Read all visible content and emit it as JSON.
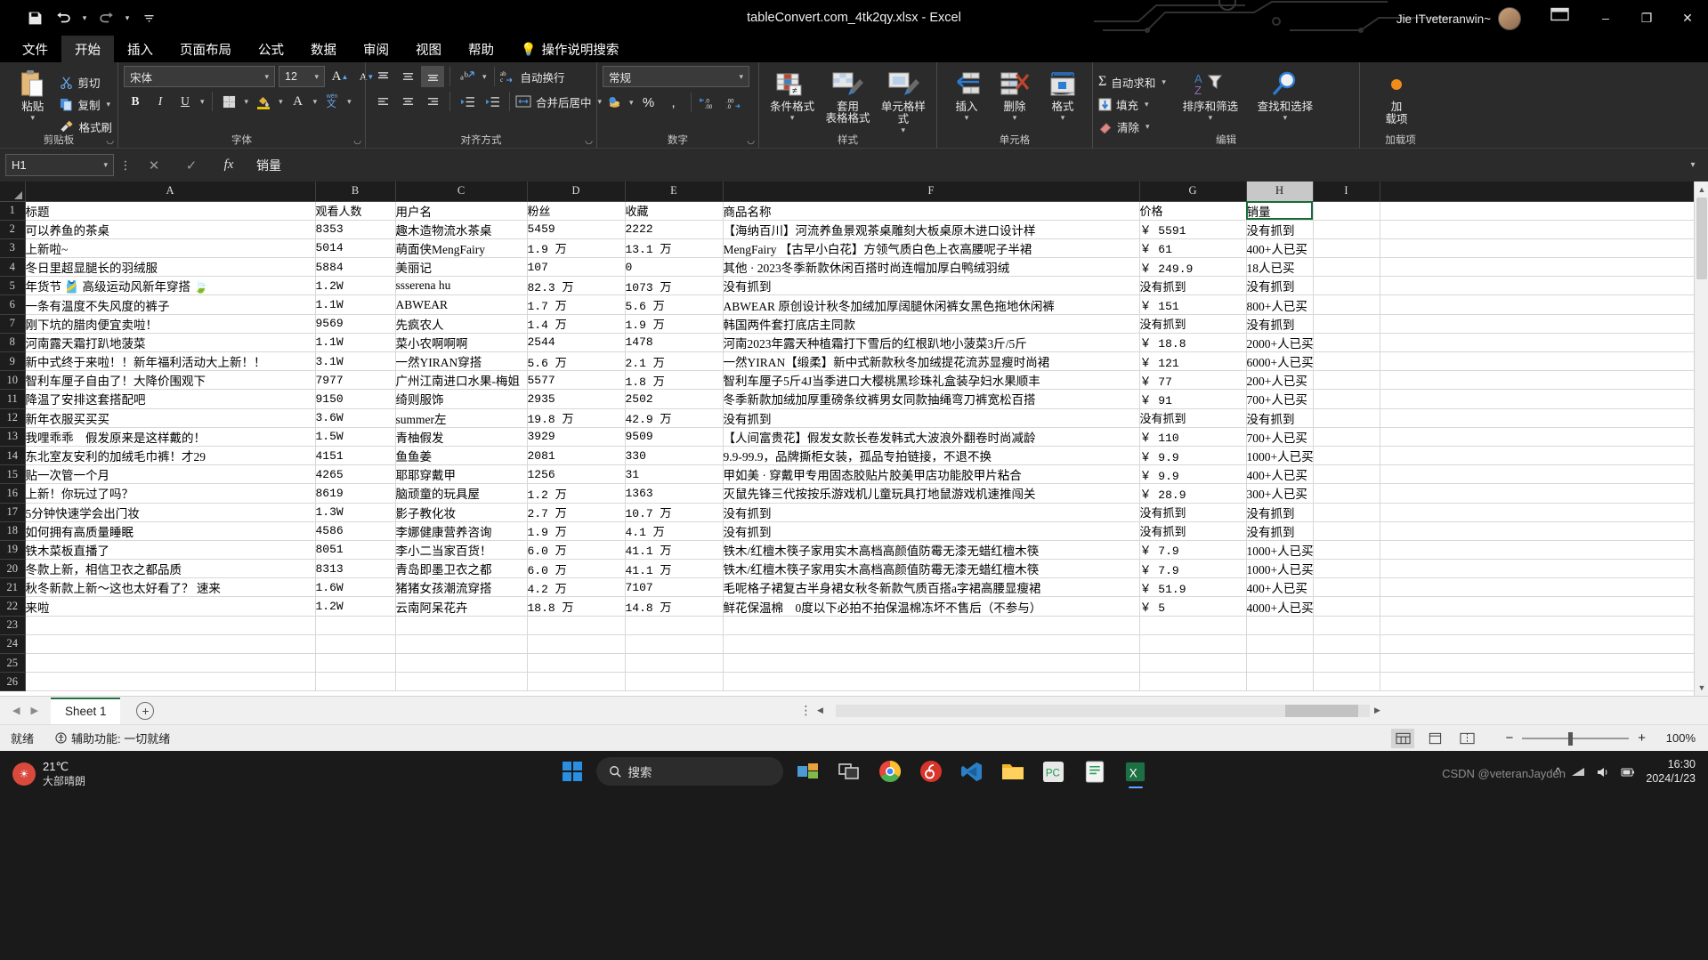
{
  "titlebar": {
    "document_title": "tableConvert.com_4tk2qy.xlsx  -  Excel",
    "account_name": "Jie ITveteranwin~",
    "qat": {
      "save": "save-icon",
      "undo": "undo-icon",
      "redo": "redo-icon",
      "customize": "customize-icon"
    },
    "window": {
      "minimize": "–",
      "maximize": "❐",
      "close": "✕",
      "ribbon_display": "⬚"
    }
  },
  "tabs": [
    {
      "label": "文件",
      "active": false
    },
    {
      "label": "开始",
      "active": true
    },
    {
      "label": "插入",
      "active": false
    },
    {
      "label": "页面布局",
      "active": false
    },
    {
      "label": "公式",
      "active": false
    },
    {
      "label": "数据",
      "active": false
    },
    {
      "label": "审阅",
      "active": false
    },
    {
      "label": "视图",
      "active": false
    },
    {
      "label": "帮助",
      "active": false
    }
  ],
  "tell_me": "操作说明搜索",
  "ribbon": {
    "clipboard": {
      "group_label": "剪贴板",
      "paste": "粘贴",
      "cut": "剪切",
      "copy": "复制",
      "format_painter": "格式刷"
    },
    "font": {
      "group_label": "字体",
      "font_name": "宋体",
      "font_size": "12",
      "bold": "B",
      "italic": "I",
      "underline": "U",
      "grow_font": "A",
      "shrink_font": "A",
      "phonetic": "文",
      "border": "border-icon",
      "fill_color": "fill-color-icon",
      "font_color": "font-color-icon"
    },
    "alignment": {
      "group_label": "对齐方式",
      "wrap_text": "自动换行",
      "merge_center": "合并后居中",
      "orientation": "orientation-icon",
      "indent_decrease": "decrease-indent-icon",
      "indent_increase": "increase-indent-icon"
    },
    "number": {
      "group_label": "数字",
      "format": "常规",
      "currency": "currency-icon",
      "percent": "%",
      "comma": ",",
      "increase_decimal": ".00",
      "decrease_decimal": ".0"
    },
    "styles": {
      "group_label": "样式",
      "conditional": "条件格式",
      "table_format_line1": "套用",
      "table_format_line2": "表格格式",
      "cell_styles": "单元格样式"
    },
    "cells": {
      "group_label": "单元格",
      "insert": "插入",
      "delete": "删除",
      "format": "格式"
    },
    "editing": {
      "group_label": "编辑",
      "autosum": "自动求和",
      "fill": "填充",
      "clear": "清除",
      "sort_filter": "排序和筛选",
      "find_select": "查找和选择"
    },
    "addins": {
      "group_label": "加载项",
      "line1": "加",
      "line2": "载项"
    }
  },
  "formula_bar": {
    "name_box": "H1",
    "cancel": "✕",
    "enter": "✓",
    "fx": "fx",
    "value": "销量"
  },
  "grid": {
    "column_headers": [
      "A",
      "B",
      "C",
      "D",
      "E",
      "F",
      "G",
      "H",
      "I"
    ],
    "selected_column": "H",
    "selected_cell": "H1",
    "row_numbers": [
      1,
      2,
      3,
      4,
      5,
      6,
      7,
      8,
      9,
      10,
      11,
      12,
      13,
      14,
      15,
      16,
      17,
      18,
      19,
      20,
      21,
      22,
      23,
      24,
      25,
      26
    ],
    "header_row": [
      "标题",
      "观看人数",
      "用户名",
      "粉丝",
      "收藏",
      "商品名称",
      "价格",
      "销量",
      ""
    ],
    "rows": [
      [
        "可以养鱼的茶桌",
        "8353",
        "趣木造物流水茶桌",
        "5459",
        "2222",
        "【海纳百川】河流养鱼景观茶桌雕刻大板桌原木进口设计样",
        "￥ 5591",
        "没有抓到",
        ""
      ],
      [
        "上新啦~",
        "5014",
        "萌面侠MengFairy",
        "1.9 万",
        "13.1 万",
        "MengFairy 【古早小白花】方领气质白色上衣高腰呢子半裙",
        "￥ 61",
        "400+人已买",
        ""
      ],
      [
        "冬日里超显腿长的羽绒服",
        "5884",
        "美丽记",
        "107",
        "0",
        "其他 ·  2023冬季新款休闲百搭时尚连帽加厚白鸭绒羽绒",
        "￥ 249.9",
        "18人已买",
        ""
      ],
      [
        "年货节 🎽 高级运动风新年穿搭 🍃",
        "1.2W",
        "ssserena hu",
        "82.3 万",
        "1073 万",
        "没有抓到",
        "没有抓到",
        "没有抓到",
        ""
      ],
      [
        "一条有温度不失风度的裤子",
        "1.1W",
        "ABWEAR",
        "1.7 万",
        "5.6 万",
        "ABWEAR 原创设计秋冬加绒加厚阔腿休闲裤女黑色拖地休闲裤",
        "￥ 151",
        "800+人已买",
        ""
      ],
      [
        "刚下坑的腊肉便宜卖啦！",
        "9569",
        "先疯农人",
        "1.4 万",
        "1.9 万",
        "韩国两件套打底店主同款",
        "没有抓到",
        "没有抓到",
        ""
      ],
      [
        "河南露天霜打趴地菠菜",
        "1.1W",
        "菜小农啊啊啊",
        "2544",
        "1478",
        "河南2023年露天种植霜打下雪后的红根趴地小菠菜3斤/5斤",
        "￥ 18.8",
        "2000+人已买",
        ""
      ],
      [
        "新中式终于来啦！！新年福利活动大上新！！",
        "3.1W",
        "一然YIRAN穿搭",
        "5.6 万",
        "2.1 万",
        "一然YIRAN【缎柔】新中式新款秋冬加绒提花流苏显瘦时尚裙",
        "￥ 121",
        "6000+人已买",
        ""
      ],
      [
        "智利车厘子自由了！大降价围观下",
        "7977",
        "广州江南进口水果-梅姐",
        "5577",
        "1.8 万",
        "智利车厘子5斤4J当季进口大樱桃黑珍珠礼盒装孕妇水果顺丰",
        "￥ 77",
        "200+人已买",
        ""
      ],
      [
        "降温了安排这套搭配吧",
        "9150",
        "绮则服饰",
        "2935",
        "2502",
        "冬季新款加绒加厚重磅条纹裤男女同款抽绳弯刀裤宽松百搭",
        "￥ 91",
        "700+人已买",
        ""
      ],
      [
        "新年衣服买买买",
        "3.6W",
        "summer左",
        "19.8 万",
        "42.9 万",
        "没有抓到",
        "没有抓到",
        "没有抓到",
        ""
      ],
      [
        "我哩乖乖　假发原来是这样戴的！",
        "1.5W",
        "青柚假发",
        "3929",
        "9509",
        "【人间富贵花】假发女款长卷发韩式大波浪外翻卷时尚减龄",
        "￥ 110",
        "700+人已买",
        ""
      ],
      [
        "东北室友安利的加绒毛巾裤！才29",
        "4151",
        "鱼鱼姜",
        "2081",
        "330",
        "9.9-99.9，品牌撕柜女装，孤品专拍链接，不退不换",
        "￥ 9.9",
        "1000+人已买",
        ""
      ],
      [
        "贴一次管一个月",
        "4265",
        "耶耶穿戴甲",
        "1256",
        "31",
        "甲如美 ·  穿戴甲专用固态胶贴片胶美甲店功能胶甲片粘合",
        "￥ 9.9",
        "400+人已买",
        ""
      ],
      [
        "上新！你玩过了吗？",
        "8619",
        "脑顽童的玩具屋",
        "1.2 万",
        "1363",
        "灭鼠先锋三代按按乐游戏机儿童玩具打地鼠游戏机速推闯关",
        "￥ 28.9",
        "300+人已买",
        ""
      ],
      [
        "5分钟快速学会出门妆",
        "1.3W",
        "影子教化妆",
        "2.7 万",
        "10.7 万",
        "没有抓到",
        "没有抓到",
        "没有抓到",
        ""
      ],
      [
        "如何拥有高质量睡眠",
        "4586",
        "李娜健康营养咨询",
        "1.9 万",
        "4.1 万",
        "没有抓到",
        "没有抓到",
        "没有抓到",
        ""
      ],
      [
        "铁木菜板直播了",
        "8051",
        "李小二当家百货！",
        "6.0 万",
        "41.1 万",
        "铁木/红檀木筷子家用实木高档高颜值防霉无漆无蜡红檀木筷",
        "￥ 7.9",
        "1000+人已买",
        ""
      ],
      [
        "冬款上新，相信卫衣之都品质",
        "8313",
        "青岛即墨卫衣之都",
        "6.0 万",
        "41.1 万",
        "铁木/红檀木筷子家用实木高档高颜值防霉无漆无蜡红檀木筷",
        "￥ 7.9",
        "1000+人已买",
        ""
      ],
      [
        "秋冬新款上新～这也太好看了？ 速来",
        "1.6W",
        "猪猪女孩潮流穿搭",
        "4.2 万",
        "7107",
        "毛呢格子裙复古半身裙女秋冬新款气质百搭a字裙高腰显瘦裙",
        "￥ 51.9",
        "400+人已买",
        ""
      ],
      [
        "来啦",
        "1.2W",
        "云南阿呆花卉",
        "18.8 万",
        "14.8 万",
        "鲜花保温棉　0度以下必拍不拍保温棉冻坏不售后（不参与）",
        "￥ 5",
        "4000+人已买",
        ""
      ]
    ]
  },
  "sheet_tabs": {
    "sheets": [
      "Sheet 1"
    ],
    "active": "Sheet 1",
    "add_label": "+"
  },
  "status_bar": {
    "ready": "就绪",
    "accessibility": "辅助功能: 一切就绪",
    "zoom": "100%",
    "views": [
      "normal-view-icon",
      "page-layout-icon",
      "page-break-icon"
    ]
  },
  "taskbar": {
    "weather_temp": "21℃",
    "weather_desc": "大部晴朗",
    "search_placeholder": "搜索",
    "clock_time": "16:30",
    "clock_date": "2024/1/23",
    "watermark": "CSDN @veteranJayden",
    "apps": [
      "start-icon",
      "search-icon",
      "widgets-icon",
      "task-view-icon",
      "chrome-icon",
      "netease-music-icon",
      "vscode-icon",
      "explorer-icon",
      "pycharm-icon",
      "wps-icon",
      "excel-icon"
    ]
  }
}
